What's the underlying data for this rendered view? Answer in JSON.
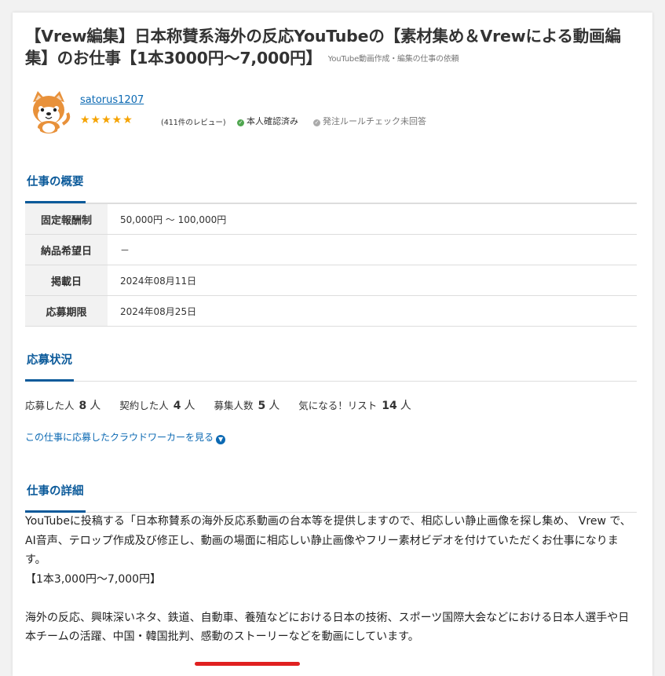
{
  "job": {
    "title": "【Vrew編集】日本称賛系海外の反応YouTubeの【素材集め＆Vrewによる動画編集】のお仕事【1本3000円～7,000円】",
    "category": "YouTube動画作成・編集の仕事の依頼"
  },
  "client": {
    "username": "satorus1207",
    "rating_stars": 5,
    "stars_text": "★★★★★",
    "reviews": "(411件のレビュー)",
    "verified": "本人確認済み",
    "verified_icon": "check-circle-icon",
    "rule_check": "発注ルールチェック未回答",
    "rule_icon": "check-circle-icon"
  },
  "overview": {
    "heading": "仕事の概要",
    "rows": [
      {
        "key": "固定報酬制",
        "value": "50,000円 ～ 100,000円"
      },
      {
        "key": "納品希望日",
        "value": "－"
      },
      {
        "key": "掲載日",
        "value": "2024年08月11日"
      },
      {
        "key": "応募期限",
        "value": "2024年08月25日"
      }
    ]
  },
  "status": {
    "heading": "応募状況",
    "items": [
      {
        "label": "応募した人",
        "count": "8",
        "unit": "人"
      },
      {
        "label": "契約した人",
        "count": "4",
        "unit": "人"
      },
      {
        "label": "募集人数",
        "count": "5",
        "unit": "人"
      },
      {
        "label": "気になる！リスト",
        "count": "14",
        "unit": "人"
      }
    ],
    "see_applicants": "この仕事に応募したクラウドワーカーを見る"
  },
  "details": {
    "heading": "仕事の詳細",
    "para1": "YouTubeに投稿する「日本称賛系の海外反応系動画の台本等を提供しますので、相応しい静止画像を探し集め、 Vrew で、AI音声、テロップ作成及び修正し、動画の場面に相応しい静止画像やフリー素材ビデオを付けていただくお仕事になります。",
    "para2": "【1本3,000円～7,000円】",
    "para3_a": "海外の反応、興味深いネタ、鉄道、自動車、養殖などにおける日本の技術、スポーツ国際大会などにおける日本人選手や日本チームの活躍、",
    "para3_b": "中国・韓国批判",
    "para3_c": "、感動のストーリーなどを動画にしています。"
  },
  "colors": {
    "accent": "#0b5a9a",
    "link": "#0b69b3",
    "star": "#f5a300",
    "verified": "#4fa64f",
    "highlight": "#e02020"
  }
}
